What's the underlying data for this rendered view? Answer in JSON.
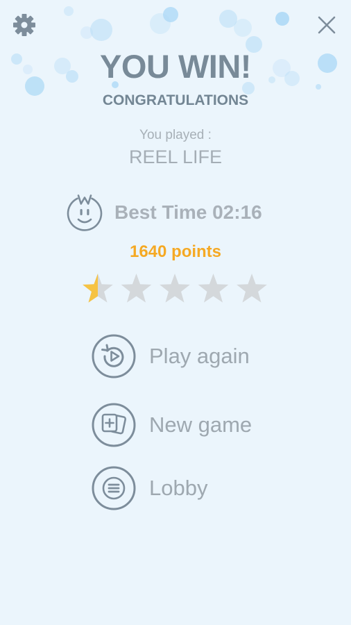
{
  "header": {
    "settings_icon": "gear-icon",
    "close_icon": "close-icon"
  },
  "result": {
    "title": "YOU WIN!",
    "subtitle": "CONGRATULATIONS",
    "played_label": "You played :",
    "game_name": "REEL LIFE",
    "best_time": "Best Time 02:16",
    "points": "1640 points",
    "rating": 0.5,
    "max_rating": 5
  },
  "menu": {
    "play_again": "Play again",
    "new_game": "New game",
    "lobby": "Lobby"
  },
  "colors": {
    "background": "#ebf5fc",
    "accent": "#f5a924",
    "icon": "#7d8d9b",
    "star_empty": "#d4d8db",
    "star_fill": "#f6c343",
    "bubble": "#aed9f6"
  }
}
